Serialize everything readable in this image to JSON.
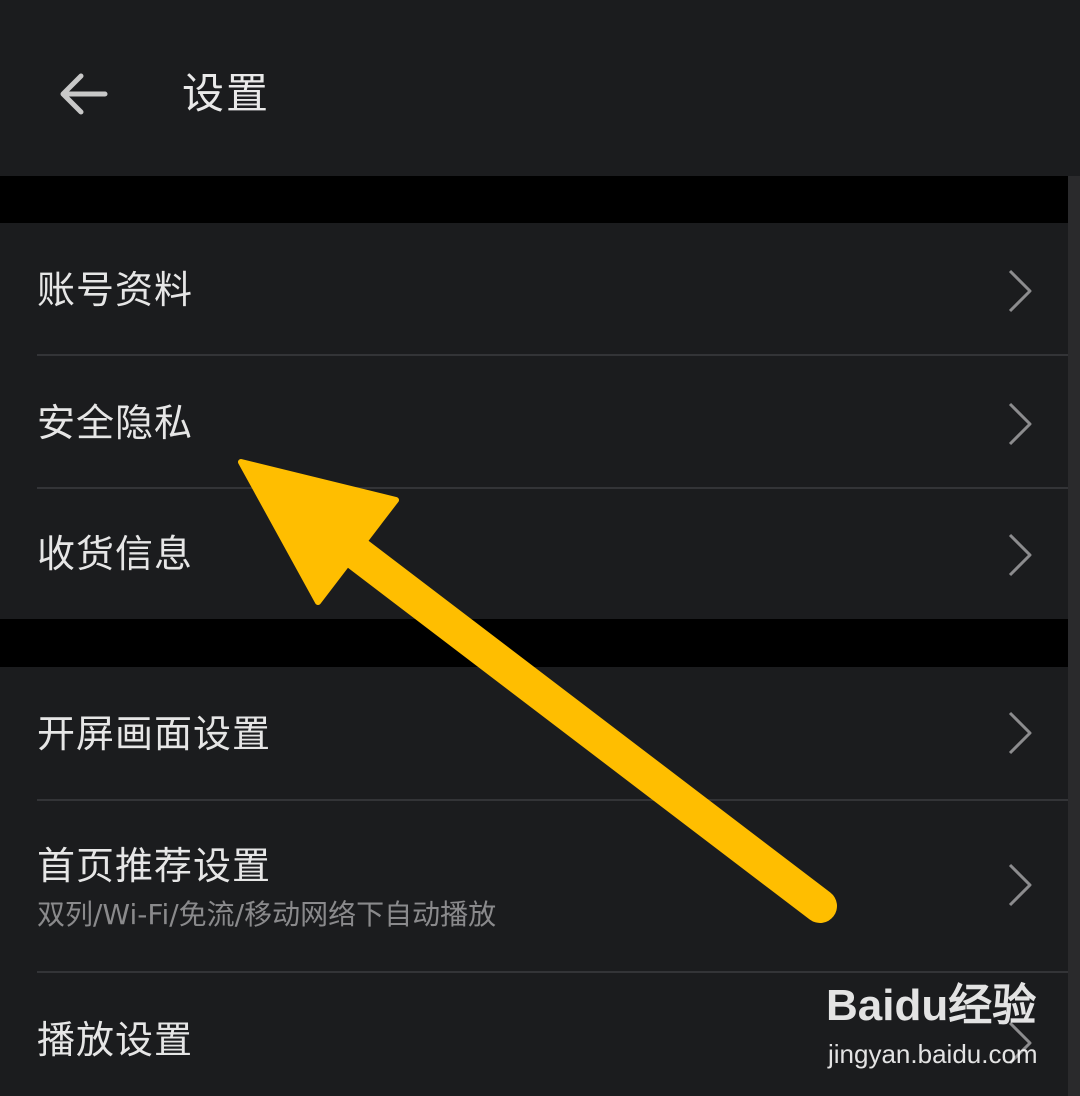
{
  "header": {
    "title": "设置",
    "back_icon": "arrow-left-icon"
  },
  "groups": [
    {
      "items": [
        {
          "label": "账号资料"
        },
        {
          "label": "安全隐私"
        },
        {
          "label": "收货信息"
        }
      ]
    },
    {
      "items": [
        {
          "label": "开屏画面设置"
        },
        {
          "label": "首页推荐设置",
          "subtitle": "双列/Wi-Fi/免流/移动网络下自动播放"
        },
        {
          "label": "播放设置"
        }
      ]
    }
  ],
  "annotation": {
    "icon": "pointer-arrow-icon",
    "color": "#ffbe00"
  },
  "watermark": {
    "brand_text": "Baidu经验",
    "url": "jingyan.baidu.com"
  },
  "colors": {
    "background": "#1b1c1e",
    "separator": "#000000",
    "text": "#e6e6e6",
    "subtext": "#8a8a8c"
  }
}
